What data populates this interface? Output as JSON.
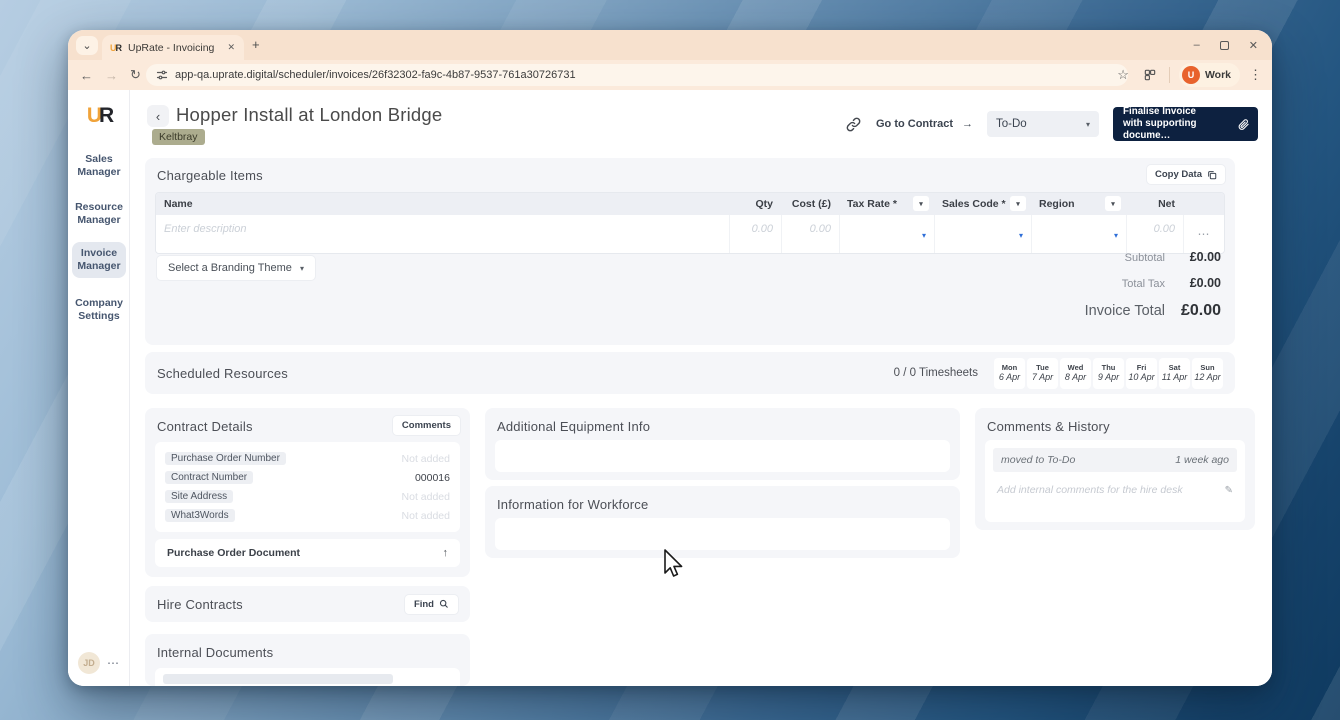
{
  "browser": {
    "tab_title": "UpRate - Invoicing",
    "url": "app-qa.uprate.digital/scheduler/invoices/26f32302-fa9c-4b87-9537-761a30726731",
    "profile": {
      "initial": "U",
      "name": "Work"
    }
  },
  "icons": {
    "chevron_down": "⌄",
    "close": "✕",
    "plus": "+",
    "minimize": "–",
    "back": "←",
    "forward": "→",
    "reload": "↻",
    "star": "☆",
    "kebab": "⋮",
    "back_chevron": "‹",
    "arrow_right": "→",
    "caret": "▾",
    "ellipsis": "⋯",
    "more_h": "⋯",
    "upload": "↑",
    "pencil": "✎"
  },
  "logo": {
    "u": "U",
    "r": "R"
  },
  "sidebar": {
    "items": [
      {
        "label": "Sales Manager"
      },
      {
        "label": "Resource Manager"
      },
      {
        "label": "Invoice Manager"
      },
      {
        "label": "Company Settings"
      }
    ],
    "avatar_initials": "JD"
  },
  "header": {
    "title": "Hopper Install at London Bridge",
    "tag": "Keltbray",
    "go_to_contract": "Go to Contract",
    "status": "To-Do",
    "finalise_line1": "Finalise Invoice",
    "finalise_line2": "with supporting docume…"
  },
  "chargeable": {
    "heading": "Chargeable Items",
    "copy_data": "Copy Data",
    "columns": [
      "Name",
      "Qty",
      "Cost (£)",
      "Tax Rate *",
      "Sales Code *",
      "Region",
      "Net"
    ],
    "row": {
      "description_placeholder": "Enter description",
      "qty_placeholder": "0.00",
      "cost_placeholder": "0.00",
      "net_placeholder": "0.00"
    },
    "branding_theme": "Select a Branding Theme",
    "totals": [
      {
        "label": "Subtotal",
        "value": "£0.00"
      },
      {
        "label": "Total Tax",
        "value": "£0.00"
      },
      {
        "label": "Invoice Total",
        "value": "£0.00"
      }
    ]
  },
  "scheduled": {
    "heading": "Scheduled Resources",
    "timesheets": "0 / 0 Timesheets",
    "days": [
      {
        "day": "Mon",
        "date": "6 Apr"
      },
      {
        "day": "Tue",
        "date": "7 Apr"
      },
      {
        "day": "Wed",
        "date": "8 Apr"
      },
      {
        "day": "Thu",
        "date": "9 Apr"
      },
      {
        "day": "Fri",
        "date": "10 Apr"
      },
      {
        "day": "Sat",
        "date": "11 Apr"
      },
      {
        "day": "Sun",
        "date": "12 Apr"
      }
    ]
  },
  "contract_details": {
    "heading": "Contract Details",
    "comments_button": "Comments",
    "fields": [
      {
        "label": "Purchase Order Number",
        "value": "Not added"
      },
      {
        "label": "Contract Number",
        "value": "000016"
      },
      {
        "label": "Site Address",
        "value": "Not added"
      },
      {
        "label": "What3Words",
        "value": "Not added"
      }
    ],
    "document_button": "Purchase Order Document"
  },
  "equipment": {
    "heading": "Additional Equipment Info"
  },
  "workforce": {
    "heading": "Information for Workforce"
  },
  "comments_history": {
    "heading": "Comments & History",
    "entry": {
      "text": "moved to To-Do",
      "time": "1 week ago"
    },
    "input_placeholder": "Add internal comments for the hire desk"
  },
  "hire": {
    "heading": "Hire Contracts",
    "find_button": "Find"
  },
  "internal_docs": {
    "heading": "Internal Documents"
  },
  "colors": {
    "accent_navy": "#0d2140",
    "brand_orange": "#f0a33a",
    "tag_olive": "#acac8e",
    "profile_orange": "#e8622c",
    "dropdown_blue": "#2f6fd8"
  }
}
